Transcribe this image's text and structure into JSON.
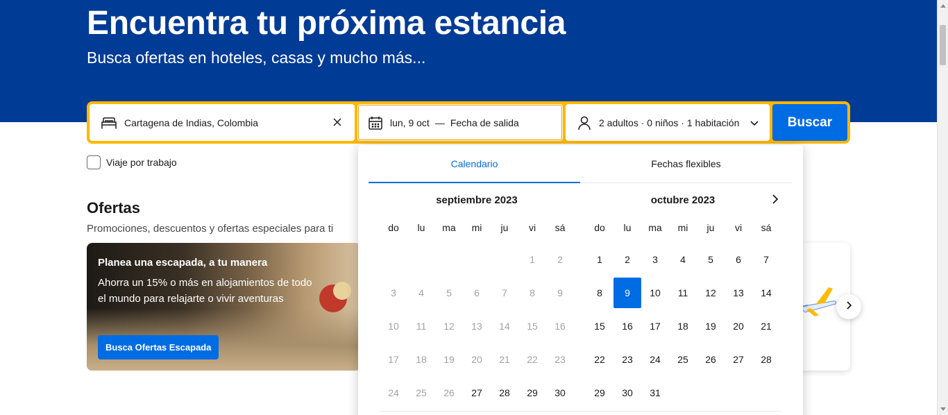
{
  "hero": {
    "title": "Encuentra tu próxima estancia",
    "subtitle": "Busca ofertas en hoteles, casas y mucho más..."
  },
  "search": {
    "destination": "Cartagena de Indias, Colombia",
    "checkin": "lun, 9 oct",
    "date_separator": "—",
    "checkout_placeholder": "Fecha de salida",
    "guests": "2 adultos · 0 niños · 1 habitación",
    "button": "Buscar"
  },
  "work_trip": {
    "label": "Viaje por trabajo",
    "checked": false
  },
  "offers": {
    "title": "Ofertas",
    "subtitle": "Promociones, descuentos y ofertas especiales para ti",
    "card": {
      "title": "Planea una escapada, a tu manera",
      "text": "Ahorra un 15% o más en alojamientos de todo el mundo para relajarte o vivir aventuras",
      "button": "Busca Ofertas Escapada"
    }
  },
  "calendar": {
    "tabs": [
      {
        "label": "Calendario",
        "active": true
      },
      {
        "label": "Fechas flexibles",
        "active": false
      }
    ],
    "weekdays": [
      "do",
      "lu",
      "ma",
      "mi",
      "ju",
      "vi",
      "sá"
    ],
    "months": [
      {
        "title": "septiembre 2023",
        "weeks": [
          [
            null,
            null,
            null,
            null,
            null,
            {
              "d": "1",
              "dis": true
            },
            {
              "d": "2",
              "dis": true
            }
          ],
          [
            {
              "d": "3",
              "dis": true
            },
            {
              "d": "4",
              "dis": true
            },
            {
              "d": "5",
              "dis": true
            },
            {
              "d": "6",
              "dis": true
            },
            {
              "d": "7",
              "dis": true
            },
            {
              "d": "8",
              "dis": true
            },
            {
              "d": "9",
              "dis": true
            }
          ],
          [
            {
              "d": "10",
              "dis": true
            },
            {
              "d": "11",
              "dis": true
            },
            {
              "d": "12",
              "dis": true
            },
            {
              "d": "13",
              "dis": true
            },
            {
              "d": "14",
              "dis": true
            },
            {
              "d": "15",
              "dis": true
            },
            {
              "d": "16",
              "dis": true
            }
          ],
          [
            {
              "d": "17",
              "dis": true
            },
            {
              "d": "18",
              "dis": true
            },
            {
              "d": "19",
              "dis": true
            },
            {
              "d": "20",
              "dis": true
            },
            {
              "d": "21",
              "dis": true
            },
            {
              "d": "22",
              "dis": true
            },
            {
              "d": "23",
              "dis": true
            }
          ],
          [
            {
              "d": "24",
              "dis": true
            },
            {
              "d": "25",
              "dis": true
            },
            {
              "d": "26",
              "dis": true
            },
            {
              "d": "27"
            },
            {
              "d": "28"
            },
            {
              "d": "29"
            },
            {
              "d": "30"
            }
          ]
        ]
      },
      {
        "title": "octubre 2023",
        "weeks": [
          [
            {
              "d": "1"
            },
            {
              "d": "2"
            },
            {
              "d": "3"
            },
            {
              "d": "4"
            },
            {
              "d": "5"
            },
            {
              "d": "6"
            },
            {
              "d": "7"
            }
          ],
          [
            {
              "d": "8"
            },
            {
              "d": "9",
              "sel": true
            },
            {
              "d": "10"
            },
            {
              "d": "11"
            },
            {
              "d": "12"
            },
            {
              "d": "13"
            },
            {
              "d": "14"
            }
          ],
          [
            {
              "d": "15"
            },
            {
              "d": "16"
            },
            {
              "d": "17"
            },
            {
              "d": "18"
            },
            {
              "d": "19"
            },
            {
              "d": "20"
            },
            {
              "d": "21"
            }
          ],
          [
            {
              "d": "22"
            },
            {
              "d": "23"
            },
            {
              "d": "24"
            },
            {
              "d": "25"
            },
            {
              "d": "26"
            },
            {
              "d": "27"
            },
            {
              "d": "28"
            }
          ],
          [
            {
              "d": "29"
            },
            {
              "d": "30"
            },
            {
              "d": "31"
            },
            null,
            null,
            null,
            null
          ]
        ]
      }
    ]
  },
  "colors": {
    "hero_bg": "#003b95",
    "search_border": "#ffb700",
    "primary": "#006ce4"
  },
  "icons": {
    "destination": "bed-icon",
    "clear": "close-icon",
    "date": "calendar-icon",
    "guests": "person-icon",
    "guests_toggle": "chevron-down-icon",
    "next_month": "chevron-right-icon",
    "carousel_next": "chevron-right-icon"
  }
}
